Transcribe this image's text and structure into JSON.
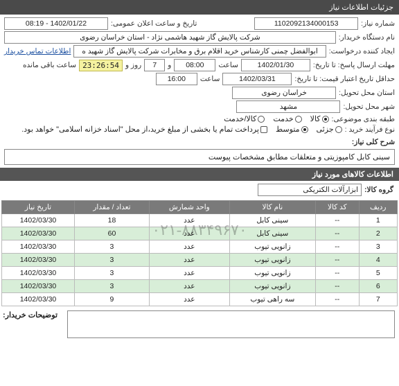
{
  "panel_title": "جزئیات اطلاعات نیاز",
  "fields": {
    "req_no_label": "شماره نیاز:",
    "req_no": "1102092134000153",
    "announce_label": "تاریخ و ساعت اعلان عمومی:",
    "announce_value": "1402/01/22 - 08:19",
    "buyer_label": "نام دستگاه خریدار:",
    "buyer_value": "شرکت پالایش گاز شهید هاشمی نژاد - استان خراسان رضوی",
    "creator_label": "ایجاد کننده درخواست:",
    "creator_value": "ابوالفضل چمنی کارشناس خرید اقلام برق و مخابرات شرکت پالایش گاز شهید ه",
    "contact_link": "اطلاعات تماس خریدار",
    "deadline_label": "مهلت ارسال پاسخ: تا تاریخ:",
    "deadline_date": "1402/01/30",
    "time_label": "ساعت",
    "deadline_time": "08:00",
    "and_label": "و",
    "days_value": "7",
    "days_label": "روز و",
    "countdown": "23:26:54",
    "remaining_label": "ساعت باقی مانده",
    "validity_label": "حداقل تاریخ اعتبار قیمت: تا تاریخ:",
    "validity_date": "1402/03/31",
    "validity_time": "16:00",
    "province_label": "استان محل تحویل:",
    "province_value": "خراسان رضوی",
    "city_label": "شهر محل تحویل:",
    "city_value": "مشهد",
    "category_label": "طبقه بندی موضوعی:",
    "cat_goods": "کالا",
    "cat_service": "خدمت",
    "cat_both": "کالا/خدمت",
    "process_label": "نوع فرآیند خرید :",
    "proc_small": "جزئی",
    "proc_medium": "متوسط",
    "proc_note": "پرداخت تمام یا بخشی از مبلغ خرید،از محل \"اسناد خزانه اسلامی\" خواهد بود.",
    "desc_label": "شرح کلی نیاز:",
    "desc_value": "سینی کابل کامپوزیتی و متعلقات مطابق مشخصات پیوست",
    "items_header": "اطلاعات کالاهای مورد نیاز",
    "group_label": "گروه کالا:",
    "group_value": "ابزارآلات الکتریکی",
    "notes_label": "توضیحات خریدار:"
  },
  "table": {
    "headers": [
      "ردیف",
      "کد کالا",
      "نام کالا",
      "واحد شمارش",
      "تعداد / مقدار",
      "تاریخ نیاز"
    ],
    "rows": [
      {
        "n": "1",
        "code": "--",
        "name": "سینی کابل",
        "unit": "عدد",
        "qty": "18",
        "date": "1402/03/30"
      },
      {
        "n": "2",
        "code": "--",
        "name": "سینی کابل",
        "unit": "عدد",
        "qty": "60",
        "date": "1402/03/30"
      },
      {
        "n": "3",
        "code": "--",
        "name": "زانویی تیوب",
        "unit": "عدد",
        "qty": "3",
        "date": "1402/03/30"
      },
      {
        "n": "4",
        "code": "--",
        "name": "زانویی تیوب",
        "unit": "عدد",
        "qty": "3",
        "date": "1402/03/30"
      },
      {
        "n": "5",
        "code": "--",
        "name": "زانویی تیوب",
        "unit": "عدد",
        "qty": "3",
        "date": "1402/03/30"
      },
      {
        "n": "6",
        "code": "--",
        "name": "زانویی تیوب",
        "unit": "عدد",
        "qty": "3",
        "date": "1402/03/30"
      },
      {
        "n": "7",
        "code": "--",
        "name": "سه راهی تیوب",
        "unit": "عدد",
        "qty": "9",
        "date": "1402/03/30"
      }
    ]
  },
  "watermark": "۰۲۱-۸۸۳۴۹۶۷۰"
}
